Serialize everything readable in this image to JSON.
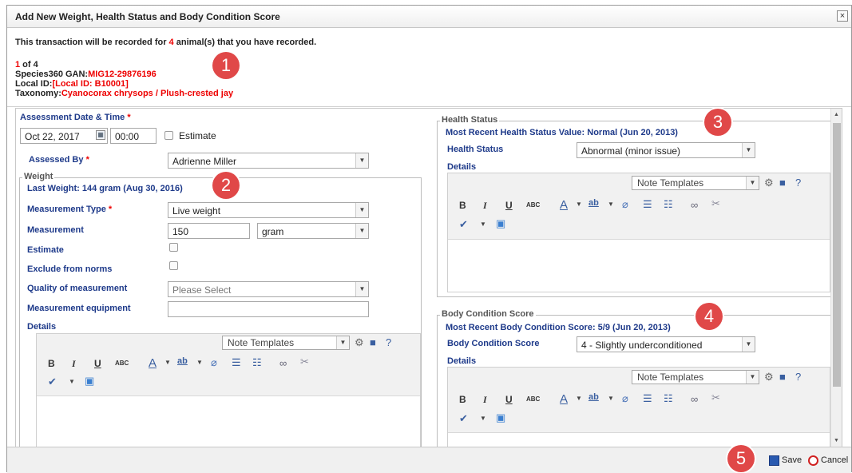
{
  "dialog": {
    "title": "Add New Weight, Health Status and Body Condition Score",
    "close": "×"
  },
  "info": {
    "line_pre": "This transaction will be recorded for ",
    "count": "4",
    "line_post": " animal(s) that you have recorded.",
    "index_current": "1",
    "index_rest": " of 4",
    "gan_label": "Species360 GAN:",
    "gan_value": "MIG12-29876196",
    "localid_label": "Local ID:",
    "localid_value": "[Local ID: B10001]",
    "taxonomy_label": "Taxonomy:",
    "taxonomy_value": "Cyanocorax chrysops / Plush-crested jay"
  },
  "assessment": {
    "label": "Assessment Date & Time",
    "required": "*",
    "date": "Oct 22, 2017",
    "time": "00:00",
    "estimate_label": "Estimate",
    "assessed_by_label": "Assessed By",
    "assessed_by_value": "Adrienne Miller"
  },
  "weight": {
    "legend": "Weight",
    "last": "Last Weight: 144 gram (Aug 30, 2016)",
    "measurement_type_label": "Measurement Type",
    "measurement_type_value": "Live weight",
    "measurement_label": "Measurement",
    "measurement_value": "150",
    "unit_value": "gram",
    "estimate_label": "Estimate",
    "exclude_label": "Exclude from norms",
    "quality_label": "Quality of measurement",
    "quality_placeholder": "Please Select",
    "equipment_label": "Measurement equipment",
    "details_label": "Details"
  },
  "health": {
    "legend": "Health Status",
    "recent": "Most Recent Health Status Value: Normal (Jun 20, 2013)",
    "label": "Health Status",
    "value": "Abnormal (minor issue)",
    "details_label": "Details"
  },
  "bcs": {
    "legend": "Body Condition Score",
    "recent": "Most Recent Body Condition Score: 5/9 (Jun 20, 2013)",
    "label": "Body Condition Score",
    "value": "4 - Slightly underconditioned",
    "details_label": "Details"
  },
  "editor": {
    "note_templates": "Note Templates",
    "bold": "B",
    "italic": "I",
    "underline": "U",
    "strike": "ABC",
    "font_color": "A",
    "highlight": "ab"
  },
  "footer": {
    "save": "Save",
    "cancel": "Cancel"
  },
  "callouts": [
    "1",
    "2",
    "3",
    "4",
    "5"
  ],
  "colors": {
    "required": "#e00000",
    "label": "#1e3a8a",
    "callout": "#e04848"
  }
}
